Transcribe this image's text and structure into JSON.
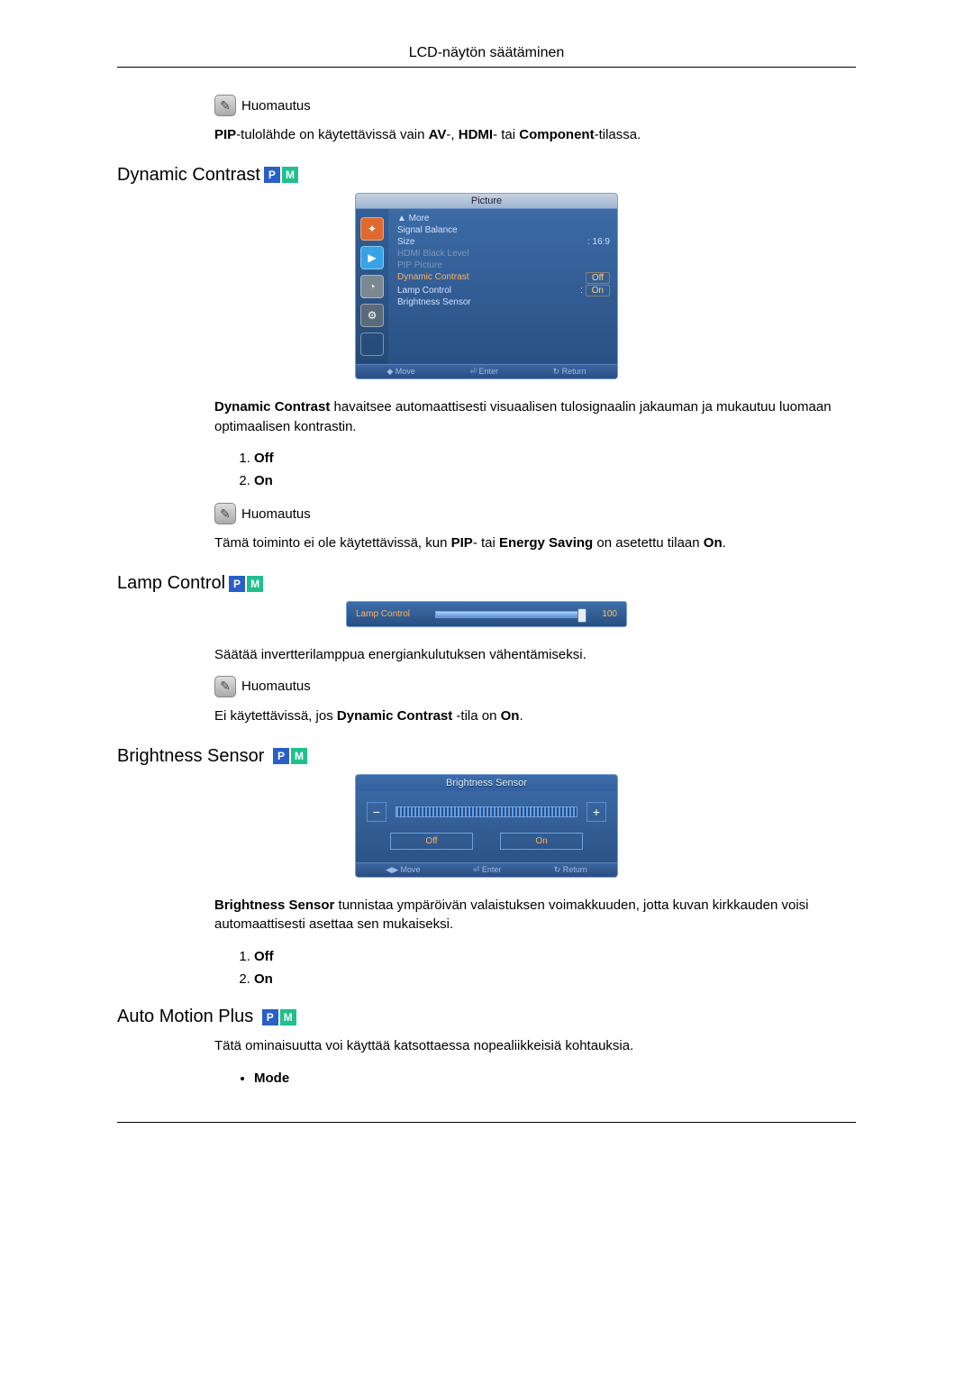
{
  "header": {
    "title": "LCD-näytön säätäminen"
  },
  "notes": {
    "label": "Huomautus",
    "pip_source": "PIP-tulolähde on käytettävissä vain AV-, HDMI- tai Component-tilassa."
  },
  "dynamic_contrast": {
    "heading": "Dynamic Contrast",
    "desc_prefix": "Dynamic Contrast",
    "desc_rest": " havaitsee automaattisesti visuaalisen tulosignaalin jakauman ja mukautuu luomaan optimaalisen kontrastin.",
    "options": [
      "Off",
      "On"
    ],
    "note": "Tämä toiminto ei ole käytettävissä, kun PIP- tai Energy Saving on asetettu tilaan On."
  },
  "lamp_control": {
    "heading": "Lamp Control",
    "desc": "Säätää invertterilamppua energiankulutuksen vähentämiseksi.",
    "note": "Ei käytettävissä, jos Dynamic Contrast ­tila on On."
  },
  "brightness_sensor": {
    "heading": "Brightness Sensor",
    "desc_prefix": "Brightness Sensor",
    "desc_rest": " tunnistaa ympäröivän valaistuksen voimakkuuden, jotta kuvan kirkkauden voisi automaattisesti asettaa sen mukaiseksi.",
    "options": [
      "Off",
      "On"
    ]
  },
  "auto_motion_plus": {
    "heading": "Auto Motion Plus",
    "desc": "Tätä ominaisuutta voi käyttää katsottaessa nopealiikkeisiä kohtauksia.",
    "bullets": [
      "Mode"
    ]
  },
  "osd_picture": {
    "title": "Picture",
    "items": [
      {
        "label": "▲ More",
        "value": ""
      },
      {
        "label": "Signal Balance",
        "value": ""
      },
      {
        "label": "Size",
        "value": "16:9"
      },
      {
        "label": "HDMI Black Level",
        "value": "",
        "dim": true
      },
      {
        "label": "PIP Picture",
        "value": "",
        "dim": true
      },
      {
        "label": "Dynamic Contrast",
        "value": "Off",
        "hl": true
      },
      {
        "label": "Lamp Control",
        "value": "On",
        "boxed": true
      },
      {
        "label": "Brightness Sensor",
        "value": ""
      }
    ],
    "nav": {
      "move": "Move",
      "enter": "Enter",
      "return": "Return"
    }
  },
  "osd_lamp": {
    "label": "Lamp Control",
    "value": "100"
  },
  "osd_bs": {
    "title": "Brightness Sensor",
    "minus": "−",
    "plus": "+",
    "off": "Off",
    "on": "On",
    "nav": {
      "move": "Move",
      "enter": "Enter",
      "return": "Return"
    }
  }
}
